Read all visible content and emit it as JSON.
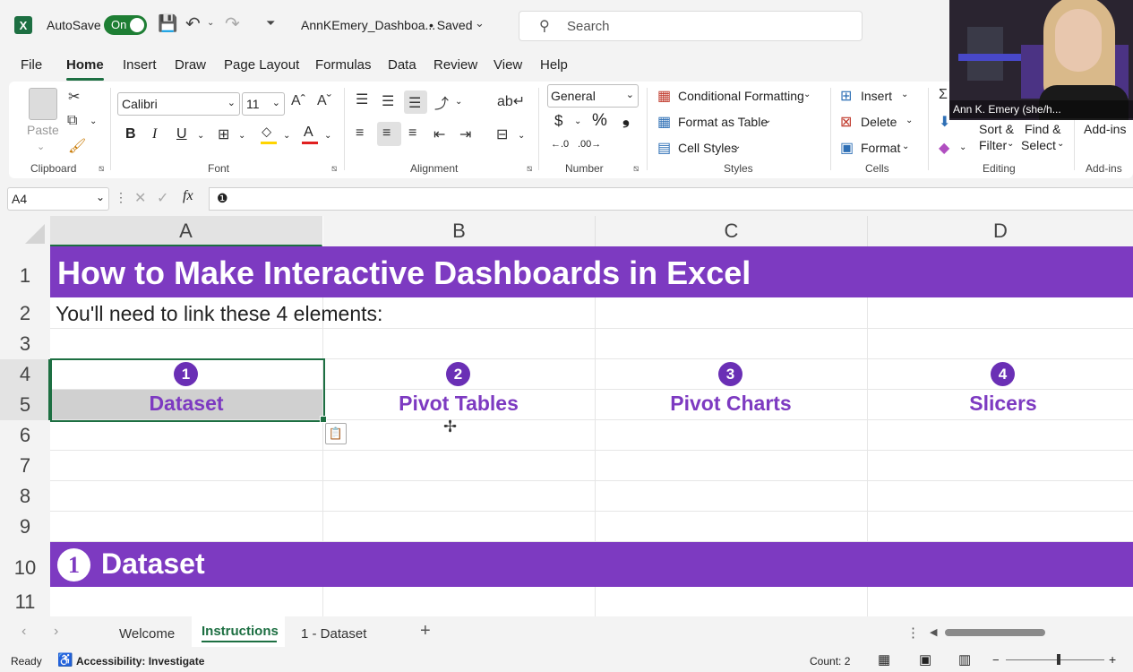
{
  "titlebar": {
    "app_icon": "excel-icon",
    "autosave_label": "AutoSave",
    "autosave_state": "On",
    "filename": "AnnKEmery_Dashboa...",
    "saved_state": "• Saved",
    "search_placeholder": "Search"
  },
  "menu": [
    "File",
    "Home",
    "Insert",
    "Draw",
    "Page Layout",
    "Formulas",
    "Data",
    "Review",
    "View",
    "Help"
  ],
  "ribbon": {
    "clipboard": {
      "paste": "Paste",
      "label": "Clipboard"
    },
    "font": {
      "name": "Calibri",
      "size": "11",
      "bold": "B",
      "italic": "I",
      "underline": "U",
      "label": "Font"
    },
    "alignment": {
      "label": "Alignment"
    },
    "number": {
      "format": "General",
      "dollar": "$",
      "percent": "%",
      "comma": "❟",
      "label": "Number"
    },
    "styles": {
      "conditional": "Conditional Formatting",
      "format_table": "Format as Table",
      "cell_styles": "Cell Styles",
      "label": "Styles"
    },
    "cells": {
      "insert": "Insert",
      "delete": "Delete",
      "format": "Format",
      "label": "Cells"
    },
    "editing": {
      "sort": "Sort &",
      "filter": "Filter",
      "find": "Find &",
      "select": "Select",
      "label": "Editing"
    },
    "addins": {
      "button": "Add-ins",
      "label": "Add-ins"
    }
  },
  "formula_bar": {
    "name_box": "A4",
    "fx": "fx",
    "content": "❶"
  },
  "columns": [
    "A",
    "B",
    "C",
    "D"
  ],
  "rows": [
    "1",
    "2",
    "3",
    "4",
    "5",
    "6",
    "7",
    "8",
    "9",
    "10",
    "11"
  ],
  "sheet": {
    "title": "How to Make Interactive Dashboards in Excel",
    "subtitle": "You'll need to link these 4 elements:",
    "elements": [
      {
        "num": "1",
        "label": "Dataset"
      },
      {
        "num": "2",
        "label": "Pivot Tables"
      },
      {
        "num": "3",
        "label": "Pivot Charts"
      },
      {
        "num": "4",
        "label": "Slicers"
      }
    ],
    "section_num": "1",
    "section_title": "Dataset"
  },
  "tabs": [
    "Welcome",
    "Instructions",
    "1 - Dataset"
  ],
  "active_tab": "Instructions",
  "status": {
    "ready": "Ready",
    "accessibility": "Accessibility: Investigate",
    "count": "Count: 2"
  },
  "webcam": {
    "name": "Ann K. Emery (she/h..."
  },
  "colors": {
    "accent_green": "#1d6f42",
    "purple": "#7d3ac1"
  }
}
